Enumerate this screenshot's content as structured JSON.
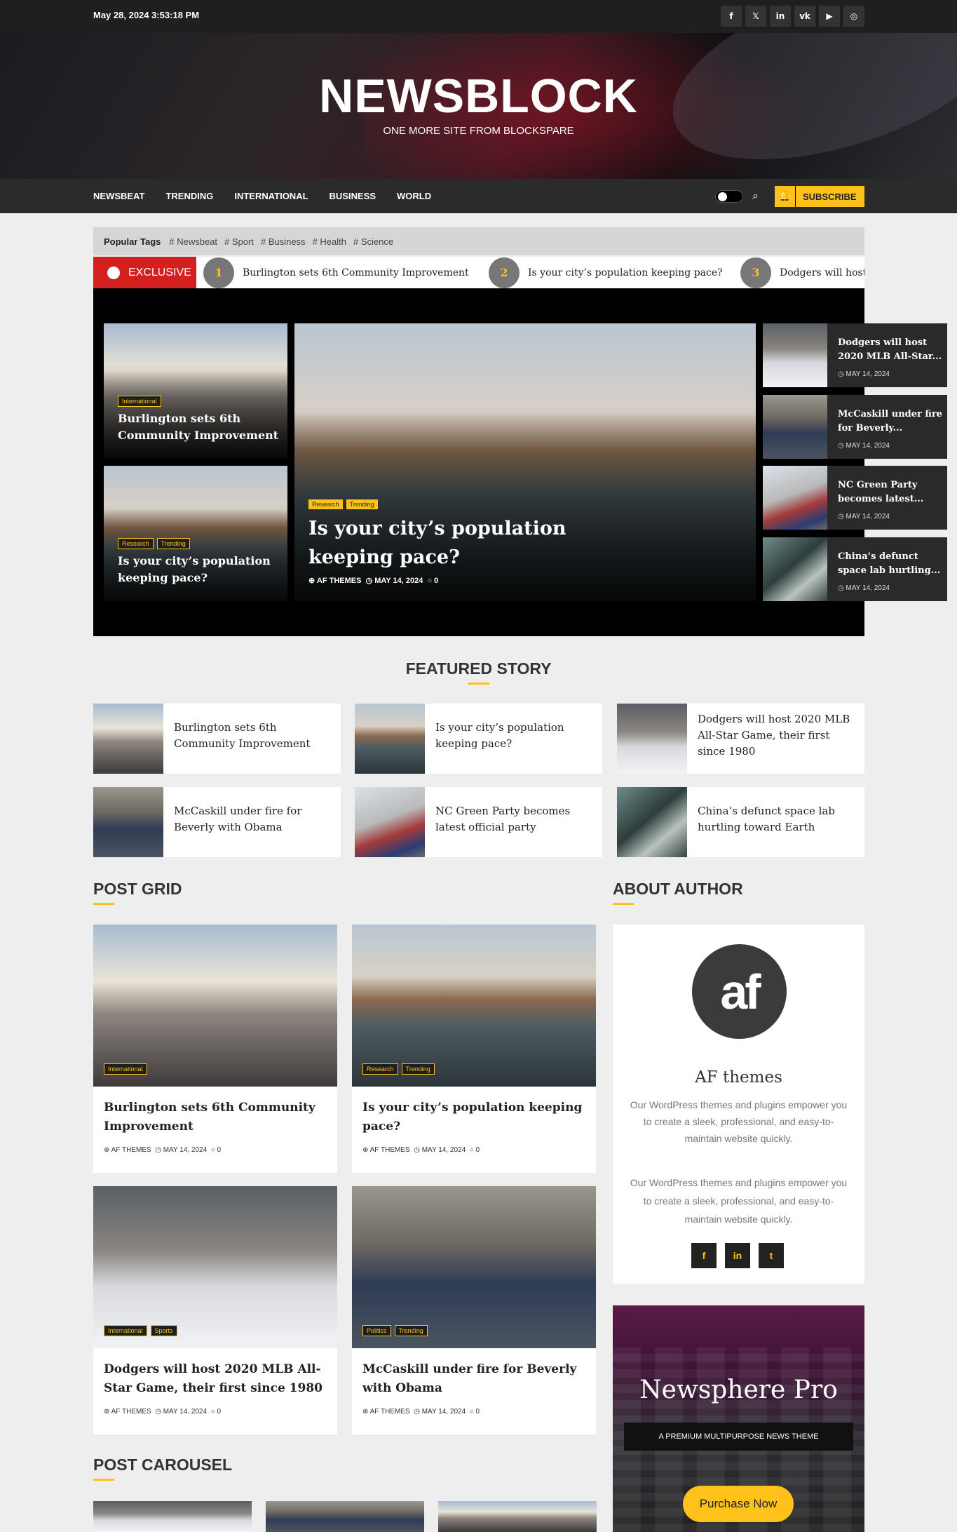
{
  "topbar": {
    "datetime": "May 28, 2024 3:53:18 PM",
    "social": [
      {
        "icon": "facebook-icon",
        "glyph": "f"
      },
      {
        "icon": "x-icon",
        "glyph": "𝕏"
      },
      {
        "icon": "linkedin-icon",
        "glyph": "in"
      },
      {
        "icon": "vk-icon",
        "glyph": "vk"
      },
      {
        "icon": "youtube-icon",
        "glyph": "▶"
      },
      {
        "icon": "instagram-icon",
        "glyph": "◎"
      }
    ]
  },
  "header": {
    "logo": "NEWSBLOCK",
    "tagline": "ONE MORE SITE FROM BLOCKSPARE"
  },
  "nav": {
    "items": [
      "NEWSBEAT",
      "TRENDING",
      "INTERNATIONAL",
      "BUSINESS",
      "WORLD"
    ],
    "subscribe_label": "SUBSCRIBE"
  },
  "tags": {
    "label": "Popular Tags",
    "items": [
      "Newsbeat",
      "Sport",
      "Business",
      "Health",
      "Science"
    ]
  },
  "ticker": {
    "label": "EXCLUSIVE",
    "items": [
      {
        "num": "1",
        "title": "Burlington sets 6th Community Improvement"
      },
      {
        "num": "2",
        "title": "Is your city’s population keeping pace?"
      },
      {
        "num": "3",
        "title": "Dodgers will host"
      }
    ]
  },
  "hero": {
    "left": [
      {
        "title": "Burlington sets 6th Community Improvement",
        "cats": [
          "International"
        ]
      },
      {
        "title": "Is your city’s population keeping pace?",
        "cats": [
          "Research",
          "Trending"
        ]
      }
    ],
    "main": {
      "title": "Is your city’s population keeping pace?",
      "cats": [
        "Research",
        "Trending"
      ],
      "author": "AF THEMES",
      "date": "MAY 14, 2024",
      "comments": "0"
    },
    "side": [
      {
        "title": "Dodgers will host 2020 MLB All-Star...",
        "date": "MAY 14, 2024"
      },
      {
        "title": "McCaskill under fire for Beverly...",
        "date": "MAY 14, 2024"
      },
      {
        "title": "NC Green Party becomes latest...",
        "date": "MAY 14, 2024"
      },
      {
        "title": "China’s defunct space lab hurtling...",
        "date": "MAY 14, 2024"
      }
    ]
  },
  "featured": {
    "title": "FEATURED STORY",
    "items": [
      "Burlington sets 6th Community Improvement",
      "Is your city’s population keeping pace?",
      "Dodgers will host 2020 MLB All-Star Game, their first since 1980",
      "McCaskill under fire for Beverly with Obama",
      "NC Green Party becomes latest official party",
      "China’s defunct space lab hurtling toward Earth"
    ]
  },
  "post_grid": {
    "title": "POST GRID",
    "items": [
      {
        "title": "Burlington sets 6th Community Improvement",
        "cats": [
          "International"
        ],
        "author": "AF THEMES",
        "date": "MAY 14, 2024",
        "comments": "0"
      },
      {
        "title": "Is your city’s population keeping pace?",
        "cats": [
          "Research",
          "Trending"
        ],
        "author": "AF THEMES",
        "date": "MAY 14, 2024",
        "comments": "0"
      },
      {
        "title": "Dodgers will host 2020 MLB All-Star Game, their first since 1980",
        "cats": [
          "International",
          "Sports"
        ],
        "author": "AF THEMES",
        "date": "MAY 14, 2024",
        "comments": "0"
      },
      {
        "title": "McCaskill under fire for Beverly with Obama",
        "cats": [
          "Politics",
          "Trending"
        ],
        "author": "AF THEMES",
        "date": "MAY 14, 2024",
        "comments": "0"
      }
    ]
  },
  "about": {
    "title": "ABOUT AUTHOR",
    "logo": "af",
    "name": "AF themes",
    "desc1": "Our WordPress themes and plugins empower you to create a sleek, professional, and easy-to-maintain website quickly.",
    "desc2": "Our WordPress themes and plugins empower you to create a sleek, professional, and easy-to-maintain website quickly.",
    "social": [
      "f",
      "in",
      "t"
    ]
  },
  "promo": {
    "title": "Newsphere Pro",
    "subtitle": "A PREMIUM MULTIPURPOSE NEWS THEME",
    "button": "Purchase Now"
  },
  "carousel": {
    "title": "POST CAROUSEL"
  },
  "colors": {
    "accent": "#ffc21b",
    "exclusive": "#d41f1f",
    "topbar": "#1f1f1f",
    "nav": "#2b2b2b"
  }
}
